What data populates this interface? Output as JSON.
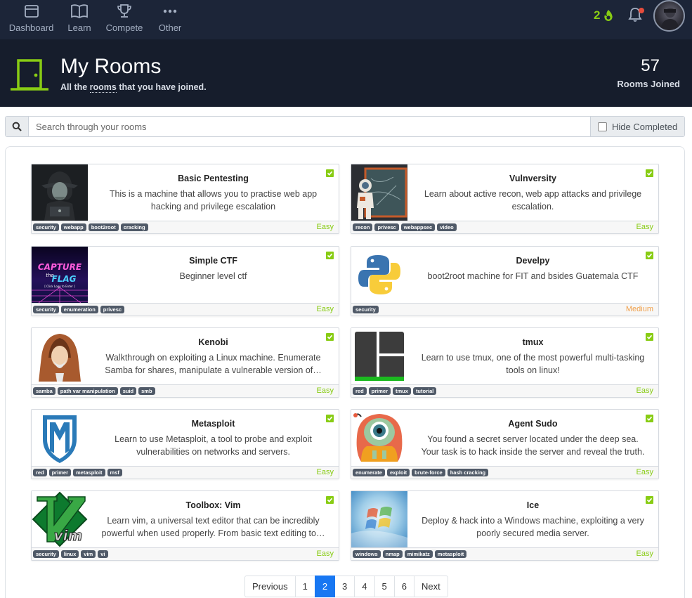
{
  "nav": {
    "items": [
      {
        "label": "Dashboard",
        "icon": "dashboard-icon"
      },
      {
        "label": "Learn",
        "icon": "book-icon"
      },
      {
        "label": "Compete",
        "icon": "trophy-icon"
      },
      {
        "label": "Other",
        "icon": "dots-icon"
      }
    ],
    "streak": "2"
  },
  "header": {
    "title": "My Rooms",
    "subtitle_pre": "All the ",
    "subtitle_link": "rooms",
    "subtitle_post": " that you have joined.",
    "joined_count": "57",
    "joined_label": "Rooms Joined"
  },
  "search": {
    "placeholder": "Search through your rooms",
    "hide_completed": "Hide Completed"
  },
  "colors": {
    "accent": "#88cc14",
    "easy": "#88cc14",
    "medium": "#f0a04b",
    "nav_bg": "#1c2538",
    "header_bg": "#161d2c",
    "pagination_active": "#1877f2"
  },
  "rooms": [
    {
      "name": "Basic Pentesting",
      "desc": "This is a machine that allows you to practise web app hacking and privilege escalation",
      "tags": [
        "security",
        "webapp",
        "boot2root",
        "cracking"
      ],
      "difficulty": "Easy",
      "completed": true
    },
    {
      "name": "Vulnversity",
      "desc": "Learn about active recon, web app attacks and privilege escalation.",
      "tags": [
        "recon",
        "privesc",
        "webappsec",
        "video"
      ],
      "difficulty": "Easy",
      "completed": true
    },
    {
      "name": "Simple CTF",
      "desc": "Beginner level ctf",
      "tags": [
        "security",
        "enumeration",
        "privesc"
      ],
      "difficulty": "Easy",
      "completed": true
    },
    {
      "name": "Develpy",
      "desc": "boot2root machine for FIT and bsides Guatemala CTF",
      "tags": [
        "security"
      ],
      "difficulty": "Medium",
      "completed": true
    },
    {
      "name": "Kenobi",
      "desc": "Walkthrough on exploiting a Linux machine. Enumerate Samba for shares, manipulate a vulnerable version of…",
      "tags": [
        "samba",
        "path var manipulation",
        "suid",
        "smb"
      ],
      "difficulty": "Easy",
      "completed": true
    },
    {
      "name": "tmux",
      "desc": "Learn to use tmux, one of the most powerful multi-tasking tools on linux!",
      "tags": [
        "red",
        "primer",
        "tmux",
        "tutorial"
      ],
      "difficulty": "Easy",
      "completed": true
    },
    {
      "name": "Metasploit",
      "desc": "Learn to use Metasploit, a tool to probe and exploit vulnerabilities on networks and servers.",
      "tags": [
        "red",
        "primer",
        "metasploit",
        "msf"
      ],
      "difficulty": "Easy",
      "completed": true
    },
    {
      "name": "Agent Sudo",
      "desc": "You found a secret server located under the deep sea. Your task is to hack inside the server and reveal the truth.",
      "tags": [
        "enumerate",
        "exploit",
        "brute-force",
        "hash cracking"
      ],
      "difficulty": "Easy",
      "completed": true
    },
    {
      "name": "Toolbox: Vim",
      "desc": "Learn vim, a universal text editor that can be incredibly powerful when used properly. From basic text editing to…",
      "tags": [
        "security",
        "linux",
        "vim",
        "vi"
      ],
      "difficulty": "Easy",
      "completed": true
    },
    {
      "name": "Ice",
      "desc": "Deploy & hack into a Windows machine, exploiting a very poorly secured media server.",
      "tags": [
        "windows",
        "nmap",
        "mimikatz",
        "metasploit"
      ],
      "difficulty": "Easy",
      "completed": true
    }
  ],
  "thumb_texts": {
    "simple_ctf_1": "CAPTURE",
    "simple_ctf_2": "the",
    "simple_ctf_3": "FLAG",
    "simple_ctf_4": "[ Click Logo to Enter ]",
    "vim": "vim"
  },
  "pagination": {
    "previous": "Previous",
    "pages": [
      "1",
      "2",
      "3",
      "4",
      "5",
      "6"
    ],
    "active": "2",
    "next": "Next"
  }
}
